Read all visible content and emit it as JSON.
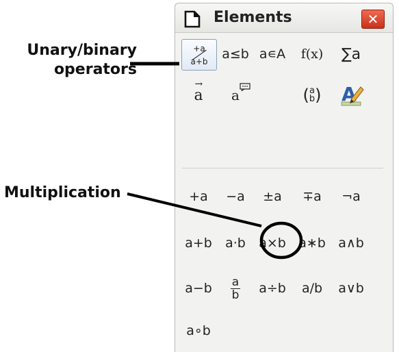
{
  "callouts": {
    "unary_line1": "Unary/binary",
    "unary_line2": "operators",
    "multiplication": "Multiplication"
  },
  "window": {
    "title": "Elements",
    "close_label": "✕"
  },
  "categories": [
    {
      "label_top": "+a",
      "label_bottom": "a+b",
      "name": "unary-binary-operators",
      "selected": true
    },
    {
      "label": "a≤b",
      "name": "relations"
    },
    {
      "label": "a∊A",
      "name": "set-operations"
    },
    {
      "label": "f(x)",
      "name": "functions"
    },
    {
      "label": "∑a",
      "name": "operators"
    },
    {
      "label": "a",
      "name": "attributes"
    },
    {
      "label": "a",
      "name": "others"
    },
    {
      "label_top": "a",
      "label_bottom": "b",
      "name": "brackets"
    },
    {
      "label": "A",
      "name": "formats"
    }
  ],
  "operators": [
    {
      "label": "+a",
      "name": "unary-plus"
    },
    {
      "label": "−a",
      "name": "unary-minus"
    },
    {
      "label": "±a",
      "name": "plus-minus"
    },
    {
      "label": "∓a",
      "name": "minus-plus"
    },
    {
      "label": "¬a",
      "name": "boolean-not"
    },
    {
      "label": "a+b",
      "name": "addition"
    },
    {
      "label": "a⋅b",
      "name": "dot-multiplication"
    },
    {
      "label": "a×b",
      "name": "multiplication"
    },
    {
      "label": "a∗b",
      "name": "asterisk-multiplication"
    },
    {
      "label": "a∧b",
      "name": "boolean-and"
    },
    {
      "label": "a−b",
      "name": "subtraction"
    },
    {
      "label_top": "a",
      "label_bottom": "b",
      "name": "fraction"
    },
    {
      "label": "a÷b",
      "name": "division"
    },
    {
      "label": "a/b",
      "name": "slash-division"
    },
    {
      "label": "a∨b",
      "name": "boolean-or"
    },
    {
      "label": "a∘b",
      "name": "concatenate"
    }
  ],
  "colors": {
    "close_button": "#d8412a",
    "highlight_circle": "#000000",
    "selected_border": "#8aa0b8"
  }
}
